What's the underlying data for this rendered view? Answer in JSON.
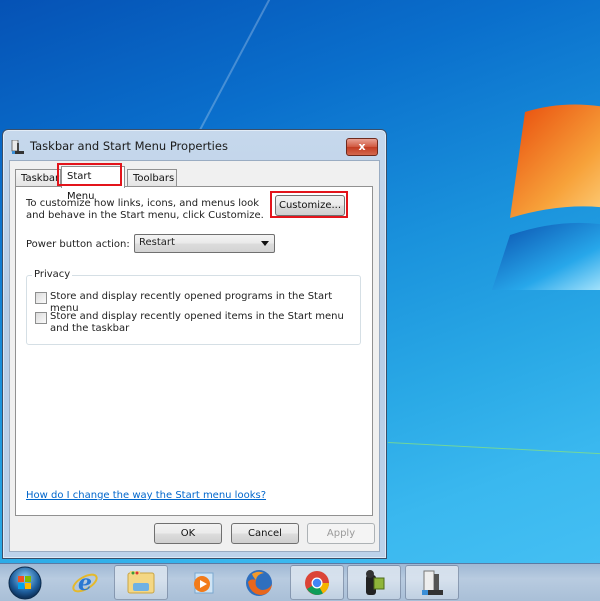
{
  "window": {
    "title": "Taskbar and Start Menu Properties",
    "close_label": "x"
  },
  "tabs": [
    {
      "label": "Taskbar",
      "active": false
    },
    {
      "label": "Start Menu",
      "active": true
    },
    {
      "label": "Toolbars",
      "active": false
    }
  ],
  "start_menu_tab": {
    "description": "To customize how links, icons, and menus look and behave in the Start menu, click Customize.",
    "customize_label": "Customize...",
    "power_button_label": "Power button action:",
    "power_button_value": "Restart",
    "privacy": {
      "group_label": "Privacy",
      "options": [
        {
          "label": "Store and display recently opened programs in the Start menu",
          "checked": false
        },
        {
          "label": "Store and display recently opened items in the Start menu and the taskbar",
          "checked": false
        }
      ]
    },
    "help_link": "How do I change the way the Start menu looks?"
  },
  "footer": {
    "ok_label": "OK",
    "cancel_label": "Cancel",
    "apply_label": "Apply",
    "apply_enabled": false
  },
  "highlights": {
    "color": "#e3141b",
    "targets": [
      "tab-start-menu",
      "customize-button"
    ]
  },
  "taskbar": {
    "items": [
      {
        "name": "start-orb",
        "icon": "windows-logo-icon"
      },
      {
        "name": "internet-explorer",
        "icon": "internet-explorer-icon"
      },
      {
        "name": "windows-explorer",
        "icon": "folder-icon"
      },
      {
        "name": "windows-media-player",
        "icon": "media-player-icon"
      },
      {
        "name": "firefox",
        "icon": "firefox-icon"
      },
      {
        "name": "chrome",
        "icon": "chrome-icon"
      },
      {
        "name": "camcorder-app",
        "icon": "camcorder-icon"
      },
      {
        "name": "taskbar-properties",
        "icon": "taskbar-properties-icon"
      }
    ]
  }
}
